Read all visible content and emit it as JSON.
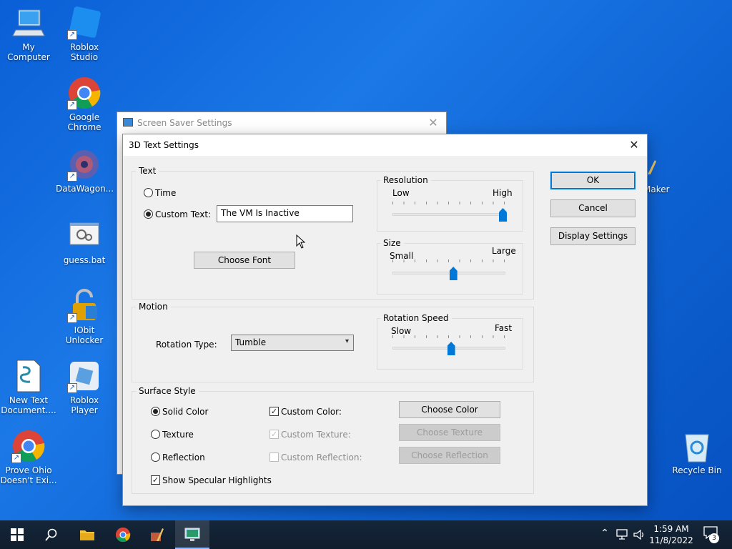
{
  "desktop": {
    "icons": [
      {
        "label": "My Computer"
      },
      {
        "label": "Roblox Studio"
      },
      {
        "label": "Google Chrome"
      },
      {
        "label": "DataWagon..."
      },
      {
        "label": "guess.bat"
      },
      {
        "label": "IObit Unlocker"
      },
      {
        "label": "New Text Document...."
      },
      {
        "label": "Roblox Player"
      },
      {
        "label": "Prove Ohio Doesn't Exi..."
      },
      {
        "label": "Recycle Bin"
      },
      {
        "label": "Maker"
      }
    ]
  },
  "back_window": {
    "title": "Screen Saver Settings",
    "close": "✕"
  },
  "dialog": {
    "title": "3D Text Settings",
    "close": "✕",
    "text_group": {
      "label": "Text",
      "time_label": "Time",
      "custom_text_label": "Custom Text:",
      "custom_text_value": "The VM Is Inactive",
      "choose_font": "Choose Font"
    },
    "resolution": {
      "label": "Resolution",
      "low": "Low",
      "high": "High",
      "value": 1.0
    },
    "size": {
      "label": "Size",
      "small": "Small",
      "large": "Large",
      "value": 0.55
    },
    "motion": {
      "label": "Motion",
      "rotation_type_label": "Rotation Type:",
      "rotation_type_value": "Tumble"
    },
    "rotation_speed": {
      "label": "Rotation Speed",
      "slow": "Slow",
      "fast": "Fast",
      "value": 0.53
    },
    "surface": {
      "label": "Surface Style",
      "solid_color": "Solid Color",
      "texture": "Texture",
      "reflection": "Reflection",
      "specular": "Show Specular Highlights",
      "custom_color": "Custom Color:",
      "custom_texture": "Custom Texture:",
      "custom_reflection": "Custom Reflection:",
      "choose_color": "Choose Color",
      "choose_texture": "Choose Texture",
      "choose_reflection": "Choose Reflection"
    },
    "buttons": {
      "ok": "OK",
      "cancel": "Cancel",
      "display_settings": "Display Settings"
    }
  },
  "taskbar": {
    "time": "1:59 AM",
    "date": "11/8/2022",
    "notification_count": "3"
  },
  "colors": {
    "accent": "#0078d7",
    "desktop": "#0a5fd6",
    "taskbar": "#14263a"
  }
}
